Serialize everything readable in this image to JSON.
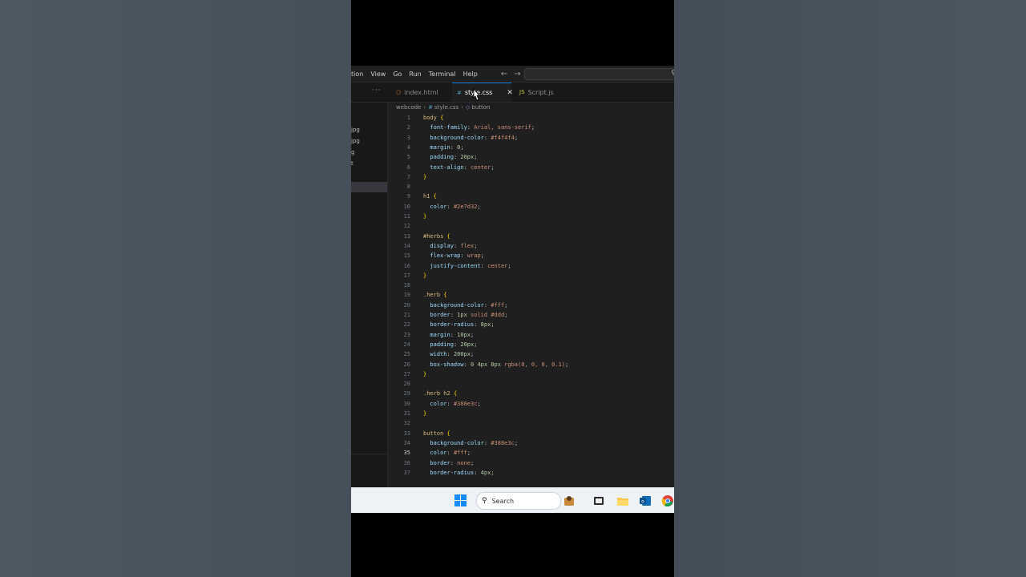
{
  "menu": {
    "items": [
      "tion",
      "View",
      "Go",
      "Run",
      "Terminal",
      "Help"
    ]
  },
  "tabs": [
    {
      "label": "index.html",
      "icon": "html-file-icon",
      "color": "#e37933"
    },
    {
      "label": "style.css",
      "icon": "css-file-icon",
      "color": "#519aba",
      "active": true
    },
    {
      "label": "Script.js",
      "icon": "js-file-icon",
      "color": "#cbcb41"
    }
  ],
  "breadcrumb": {
    "folder": "webcode",
    "file": "style.css",
    "symbol": "button"
  },
  "explorer": {
    "items": [
      "jpg",
      "jpg",
      "g",
      "t"
    ]
  },
  "editor": {
    "current_line": 35,
    "lines": [
      {
        "n": "1",
        "t": [
          [
            "sel",
            "body "
          ],
          [
            "br",
            "{"
          ]
        ]
      },
      {
        "n": "2",
        "t": [
          [
            "prop",
            "  font-family"
          ],
          [
            "pun",
            ": "
          ],
          [
            "val",
            "Arial, sans-serif"
          ],
          [
            "pun",
            ";"
          ]
        ]
      },
      {
        "n": "3",
        "t": [
          [
            "prop",
            "  background-color"
          ],
          [
            "pun",
            ": "
          ],
          [
            "val",
            "#f4f4f4"
          ],
          [
            "pun",
            ";"
          ]
        ]
      },
      {
        "n": "4",
        "t": [
          [
            "prop",
            "  margin"
          ],
          [
            "pun",
            ": "
          ],
          [
            "num",
            "0"
          ],
          [
            "pun",
            ";"
          ]
        ]
      },
      {
        "n": "5",
        "t": [
          [
            "prop",
            "  padding"
          ],
          [
            "pun",
            ": "
          ],
          [
            "num",
            "20px"
          ],
          [
            "pun",
            ";"
          ]
        ]
      },
      {
        "n": "6",
        "t": [
          [
            "prop",
            "  text-align"
          ],
          [
            "pun",
            ": "
          ],
          [
            "val",
            "center"
          ],
          [
            "pun",
            ";"
          ]
        ]
      },
      {
        "n": "7",
        "t": [
          [
            "br",
            "}"
          ]
        ]
      },
      {
        "n": "8",
        "t": []
      },
      {
        "n": "9",
        "t": [
          [
            "sel",
            "h1 "
          ],
          [
            "br",
            "{"
          ]
        ]
      },
      {
        "n": "10",
        "t": [
          [
            "prop",
            "  color"
          ],
          [
            "pun",
            ": "
          ],
          [
            "val",
            "#2e7d32"
          ],
          [
            "pun",
            ";"
          ]
        ]
      },
      {
        "n": "11",
        "t": [
          [
            "br",
            "}"
          ]
        ]
      },
      {
        "n": "12",
        "t": []
      },
      {
        "n": "13",
        "t": [
          [
            "sel",
            "#herbs "
          ],
          [
            "br",
            "{"
          ]
        ]
      },
      {
        "n": "14",
        "t": [
          [
            "prop",
            "  display"
          ],
          [
            "pun",
            ": "
          ],
          [
            "val",
            "flex"
          ],
          [
            "pun",
            ";"
          ]
        ]
      },
      {
        "n": "15",
        "t": [
          [
            "prop",
            "  flex-wrap"
          ],
          [
            "pun",
            ": "
          ],
          [
            "val",
            "wrap"
          ],
          [
            "pun",
            ";"
          ]
        ]
      },
      {
        "n": "16",
        "t": [
          [
            "prop",
            "  justify-content"
          ],
          [
            "pun",
            ": "
          ],
          [
            "val",
            "center"
          ],
          [
            "pun",
            ";"
          ]
        ]
      },
      {
        "n": "17",
        "t": [
          [
            "br",
            "}"
          ]
        ]
      },
      {
        "n": "18",
        "t": []
      },
      {
        "n": "19",
        "t": [
          [
            "sel",
            ".herb "
          ],
          [
            "br",
            "{"
          ]
        ]
      },
      {
        "n": "20",
        "t": [
          [
            "prop",
            "  background-color"
          ],
          [
            "pun",
            ": "
          ],
          [
            "val",
            "#fff"
          ],
          [
            "pun",
            ";"
          ]
        ]
      },
      {
        "n": "21",
        "t": [
          [
            "prop",
            "  border"
          ],
          [
            "pun",
            ": "
          ],
          [
            "num",
            "1px"
          ],
          [
            "val",
            " solid #ddd"
          ],
          [
            "pun",
            ";"
          ]
        ]
      },
      {
        "n": "22",
        "t": [
          [
            "prop",
            "  border-radius"
          ],
          [
            "pun",
            ": "
          ],
          [
            "num",
            "8px"
          ],
          [
            "pun",
            ";"
          ]
        ]
      },
      {
        "n": "23",
        "t": [
          [
            "prop",
            "  margin"
          ],
          [
            "pun",
            ": "
          ],
          [
            "num",
            "10px"
          ],
          [
            "pun",
            ";"
          ]
        ]
      },
      {
        "n": "24",
        "t": [
          [
            "prop",
            "  padding"
          ],
          [
            "pun",
            ": "
          ],
          [
            "num",
            "20px"
          ],
          [
            "pun",
            ";"
          ]
        ]
      },
      {
        "n": "25",
        "t": [
          [
            "prop",
            "  width"
          ],
          [
            "pun",
            ": "
          ],
          [
            "num",
            "200px"
          ],
          [
            "pun",
            ";"
          ]
        ]
      },
      {
        "n": "26",
        "t": [
          [
            "prop",
            "  box-shadow"
          ],
          [
            "pun",
            ": "
          ],
          [
            "num",
            "0 4px 8px"
          ],
          [
            "val",
            " rgba(0, 0, 0, 0.1)"
          ],
          [
            "pun",
            ";"
          ]
        ]
      },
      {
        "n": "27",
        "t": [
          [
            "br",
            "}"
          ]
        ]
      },
      {
        "n": "28",
        "t": []
      },
      {
        "n": "29",
        "t": [
          [
            "sel",
            ".herb h2 "
          ],
          [
            "br",
            "{"
          ]
        ]
      },
      {
        "n": "30",
        "t": [
          [
            "prop",
            "  color"
          ],
          [
            "pun",
            ": "
          ],
          [
            "val",
            "#388e3c"
          ],
          [
            "pun",
            ";"
          ]
        ]
      },
      {
        "n": "31",
        "t": [
          [
            "br",
            "}"
          ]
        ]
      },
      {
        "n": "32",
        "t": []
      },
      {
        "n": "33",
        "t": [
          [
            "sel",
            "button "
          ],
          [
            "br",
            "{"
          ]
        ]
      },
      {
        "n": "34",
        "t": [
          [
            "prop",
            "  background-color"
          ],
          [
            "pun",
            ": "
          ],
          [
            "val",
            "#388e3c"
          ],
          [
            "pun",
            ";"
          ]
        ]
      },
      {
        "n": "35",
        "t": [
          [
            "prop",
            "  color"
          ],
          [
            "pun",
            ": "
          ],
          [
            "val",
            "#fff"
          ],
          [
            "pun",
            ";"
          ]
        ]
      },
      {
        "n": "36",
        "t": [
          [
            "prop",
            "  border"
          ],
          [
            "pun",
            ": "
          ],
          [
            "val",
            "none"
          ],
          [
            "pun",
            ";"
          ]
        ]
      },
      {
        "n": "37",
        "t": [
          [
            "prop",
            "  border-radius"
          ],
          [
            "pun",
            ": "
          ],
          [
            "num",
            "4px"
          ],
          [
            "pun",
            ";"
          ]
        ]
      }
    ]
  },
  "taskbar": {
    "search_placeholder": "Search",
    "icons": [
      "windows-start-icon",
      "search-icon",
      "widget-icon",
      "task-view-icon",
      "file-explorer-icon",
      "outlook-icon",
      "chrome-icon"
    ]
  },
  "colors": {
    "editor_bg": "#1f1f1f",
    "accent": "#0078d4",
    "selector": "#d7ba7d",
    "property": "#9cdcfe",
    "value": "#ce9178"
  }
}
